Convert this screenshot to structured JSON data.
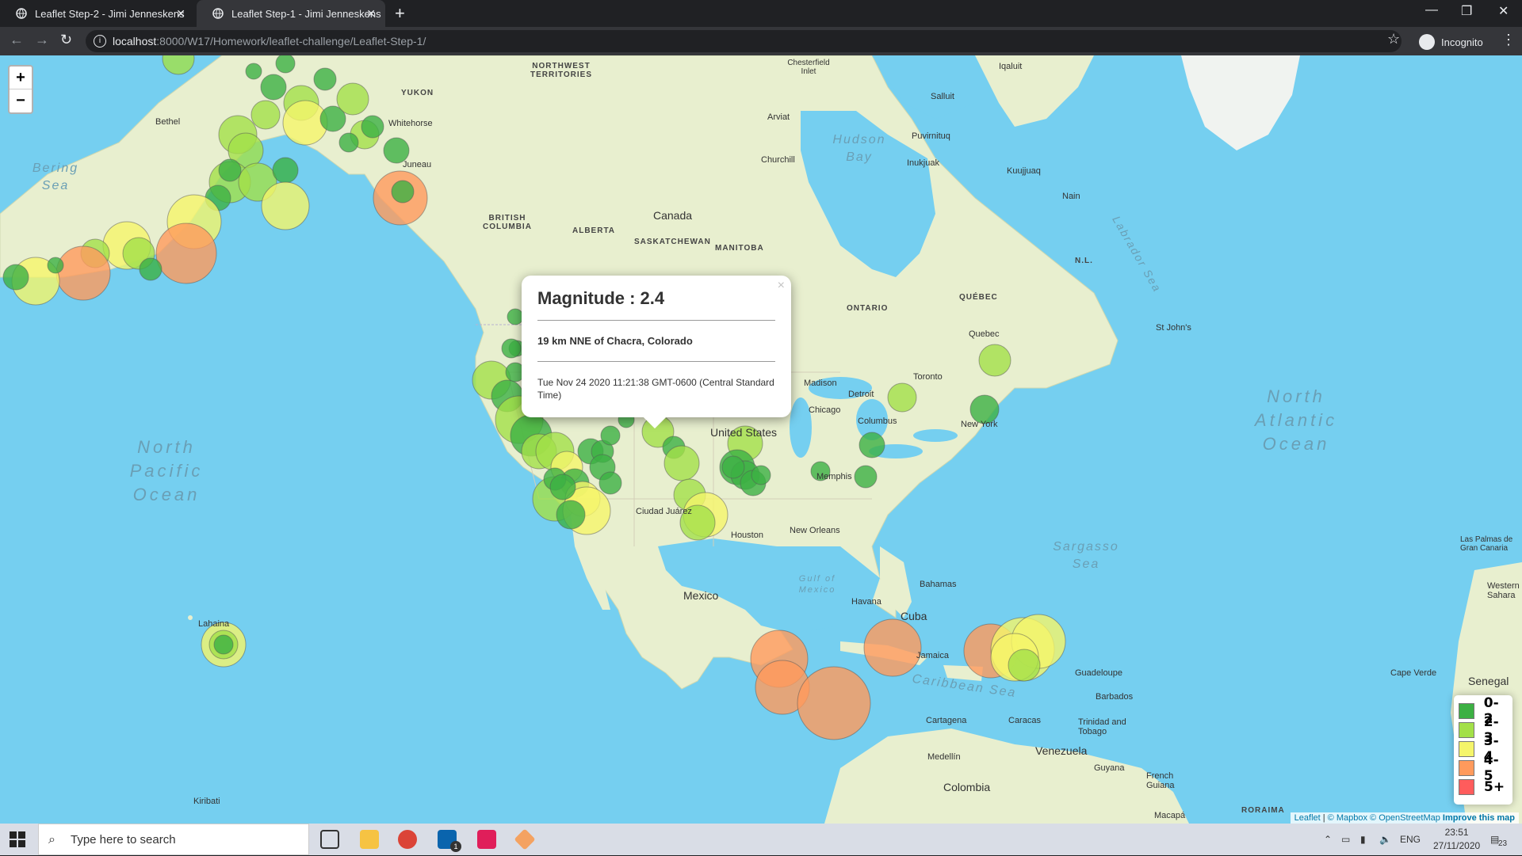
{
  "browser": {
    "tabs": [
      {
        "title": "Leaflet Step-2 - Jimi Jenneskens",
        "active": false
      },
      {
        "title": "Leaflet Step-1 - Jimi Jenneskens",
        "active": true
      }
    ],
    "url_host": "localhost",
    "url_path": ":8000/W17/Homework/leaflet-challenge/Leaflet-Step-1/",
    "profile_label": "Incognito"
  },
  "map": {
    "zoom_in": "+",
    "zoom_out": "−",
    "labels": {
      "canada": "Canada",
      "united_states": "United States",
      "mexico": "Mexico",
      "cuba": "Cuba",
      "venezuela": "Venezuela",
      "colombia": "Colombia",
      "senegal": "Senegal",
      "north_pacific_ocean": "North Pacific Ocean",
      "north_atlantic_ocean": "North Atlantic Ocean",
      "bering_sea": "Bering Sea",
      "hudson_bay": "Hudson Bay",
      "sargasso_sea": "Sargasso Sea",
      "caribbean_sea": "Caribbean Sea",
      "gulf_of_mexico": "Gulf of Mexico",
      "labrador_sea": "Labrador Sea",
      "yukon": "YUKON",
      "nwt": "NORTHWEST TERRITORIES",
      "bc": "BRITISH COLUMBIA",
      "alberta": "ALBERTA",
      "sask": "SASKATCHEWAN",
      "manitoba": "MANITOBA",
      "ontario": "ONTARIO",
      "quebec": "QUÉBEC",
      "nl": "N.L.",
      "chicago": "Chicago",
      "detroit": "Detroit",
      "toronto": "Toronto",
      "new_york": "New York",
      "columbus": "Columbus",
      "memphis": "Memphis",
      "houston": "Houston",
      "new_orleans": "New Orleans",
      "havana": "Havana",
      "bahamas": "Bahamas",
      "guadeloupe": "Guadeloupe",
      "barbados": "Barbados",
      "cape_verde": "Cape Verde",
      "churchill": "Churchill",
      "whitehorse": "Whitehorse",
      "bethel": "Bethel",
      "juneau": "Juneau",
      "lahaina": "Lahaina",
      "kiribati": "Kiribati",
      "st_johns": "St John's",
      "quebec_city": "Quebec",
      "madison": "Madison",
      "iqaluit": "Iqaluit",
      "nain": "Nain",
      "arviat": "Arviat",
      "chesterfield_inlet": "Chesterfield Inlet",
      "kuujjuaq": "Kuujjuaq",
      "salluit": "Salluit",
      "puvirnituq": "Puvirnituq",
      "inukjuak": "Inukjuak",
      "las_palmas": "Las Palmas de Gran Canaria",
      "western_sahara": "Western Sahara",
      "cartagena": "Cartagena",
      "caracas": "Caracas",
      "medellin": "Medellín",
      "guyana": "Guyana",
      "french_guiana": "French Guiana",
      "trinidad": "Trinidad and Tobago",
      "jamaica": "Jamaica",
      "ciudad_juarez": "Ciudad Juárez",
      "roraima": "RORAIMA",
      "macapa": "Macapá"
    },
    "popup": {
      "title": "Magnitude : 2.4",
      "place": "19 km NNE of Chacra, Colorado",
      "time": "Tue Nov 24 2020 11:21:38 GMT-0600 (Central Standard Time)",
      "close": "×"
    },
    "legend": [
      {
        "label": "0-2",
        "color": "#3cb043"
      },
      {
        "label": "2-3",
        "color": "#a3e048"
      },
      {
        "label": "3-4",
        "color": "#f5f56a"
      },
      {
        "label": "4-5",
        "color": "#ff9a5c"
      },
      {
        "label": "5+",
        "color": "#ff5c5c"
      }
    ],
    "attribution": {
      "leaflet": "Leaflet",
      "mapbox": "© Mapbox",
      "osm": "© OpenStreetMap",
      "improve": "Improve this map"
    }
  },
  "taskbar": {
    "search_placeholder": "Type here to search",
    "language": "ENG",
    "time": "23:51",
    "date": "27/11/2020",
    "notifications": "23",
    "mail_badge": "1"
  },
  "colors": {
    "mag_0_2": "#3cb043",
    "mag_2_3": "#a3e048",
    "mag_3_4": "#f5f56a",
    "mag_4_5": "#ff9a5c",
    "mag_5_plus": "#ff5c5c",
    "water": "#75cff0",
    "land": "#e8efcf"
  }
}
